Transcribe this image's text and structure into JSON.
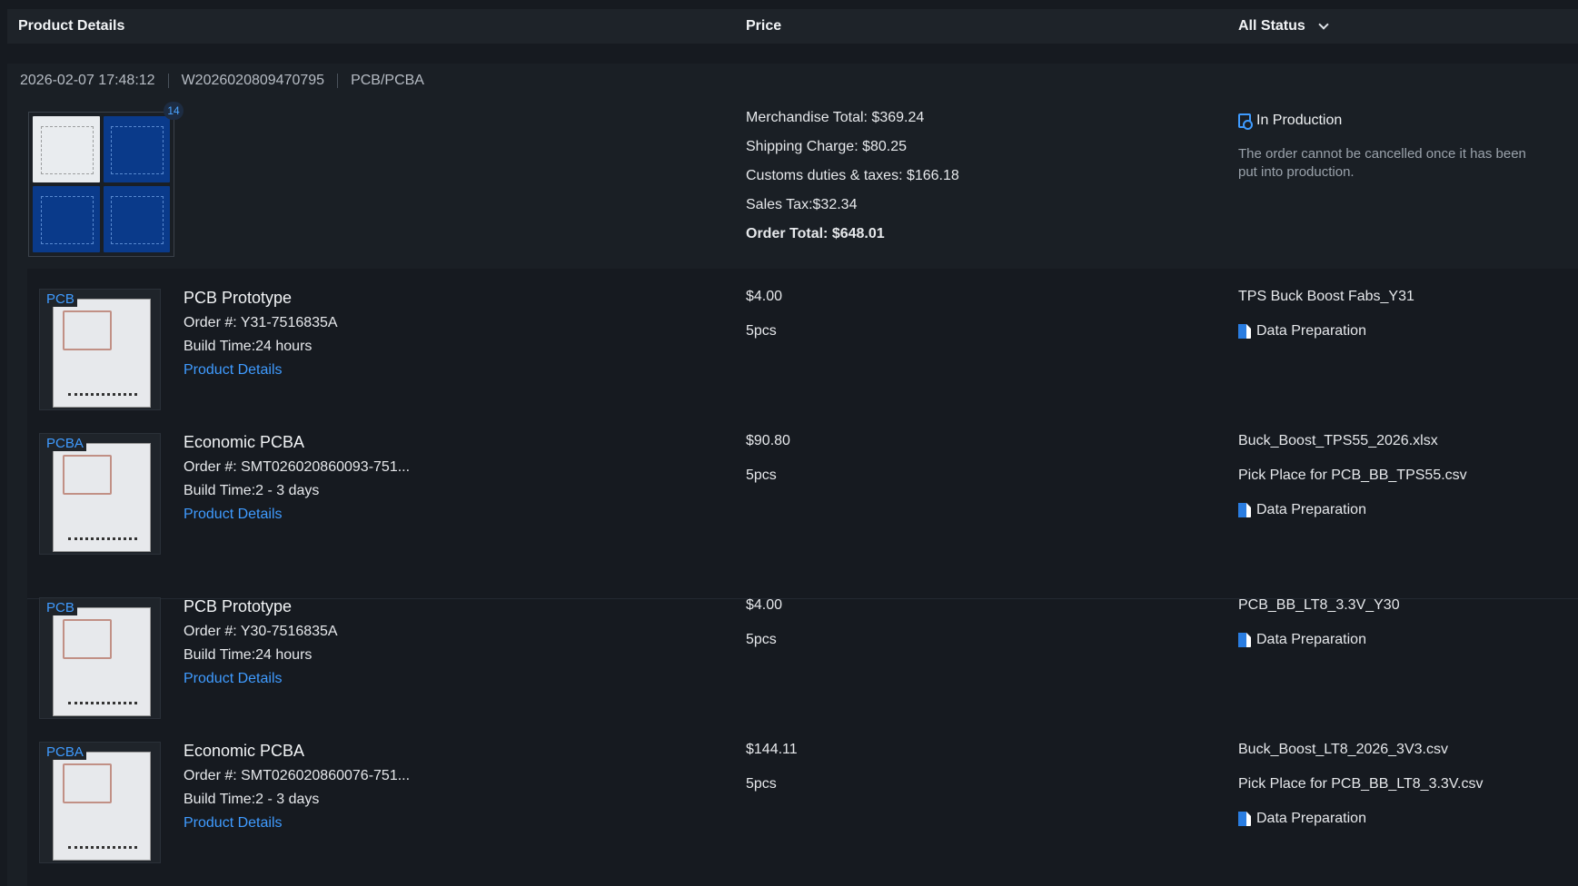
{
  "header": {
    "product_details": "Product Details",
    "price": "Price",
    "all_status": "All Status"
  },
  "order": {
    "datetime": "2026-02-07 17:48:12",
    "order_id": "W2026020809470795",
    "category": "PCB/PCBA",
    "thumb_count": "14",
    "totals": {
      "merchandise": "Merchandise Total: $369.24",
      "shipping": "Shipping Charge: $80.25",
      "customs": "Customs duties & taxes: $166.18",
      "sales_tax": "Sales Tax:$32.34",
      "order_total": "Order Total: $648.01"
    },
    "status": "In Production",
    "status_note": "The order cannot be cancelled once it has been put into production."
  },
  "items": [
    {
      "tag": "PCB",
      "title": "PCB Prototype",
      "order_no": "Order #: Y31-7516835A",
      "build_time": "Build Time:24 hours",
      "link": "Product Details",
      "price": "$4.00",
      "qty": "5pcs",
      "files": [
        "TPS Buck Boost Fabs_Y31"
      ],
      "prep": "Data Preparation"
    },
    {
      "tag": "PCBA",
      "title": "Economic PCBA",
      "order_no": "Order #: SMT026020860093-751...",
      "build_time": "Build Time:2 - 3 days",
      "link": "Product Details",
      "price": "$90.80",
      "qty": "5pcs",
      "files": [
        "Buck_Boost_TPS55_2026.xlsx",
        "Pick Place for PCB_BB_TPS55.csv"
      ],
      "prep": "Data Preparation"
    },
    {
      "tag": "PCB",
      "title": "PCB Prototype",
      "order_no": "Order #: Y30-7516835A",
      "build_time": "Build Time:24 hours",
      "link": "Product Details",
      "price": "$4.00",
      "qty": "5pcs",
      "files": [
        "PCB_BB_LT8_3.3V_Y30"
      ],
      "prep": "Data Preparation"
    },
    {
      "tag": "PCBA",
      "title": "Economic PCBA",
      "order_no": "Order #: SMT026020860076-751...",
      "build_time": "Build Time:2 - 3 days",
      "link": "Product Details",
      "price": "$144.11",
      "qty": "5pcs",
      "files": [
        "Buck_Boost_LT8_2026_3V3.csv",
        "Pick Place for PCB_BB_LT8_3.3V.csv"
      ],
      "prep": "Data Preparation"
    }
  ],
  "colors": {
    "background": "#161a20",
    "link": "#3f9bff",
    "muted": "#9aa2ab"
  }
}
